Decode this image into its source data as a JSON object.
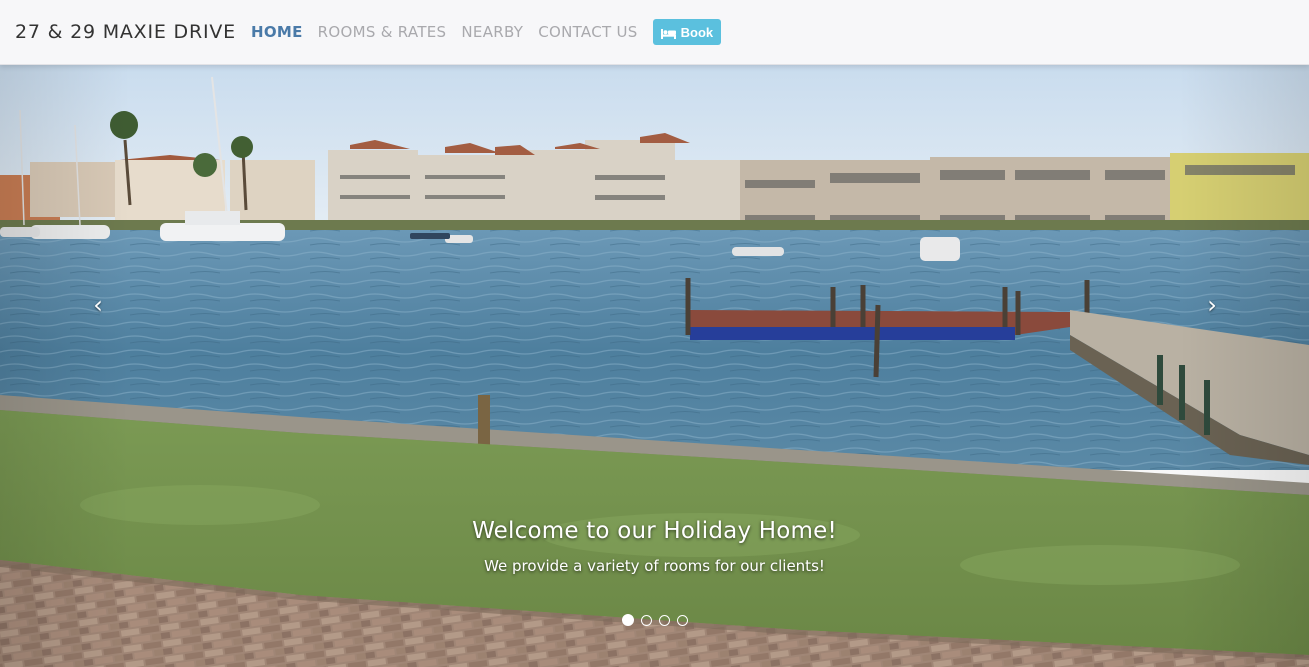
{
  "navbar": {
    "brand": "27 & 29 MAXIE DRIVE",
    "items": [
      {
        "label": "HOME",
        "active": true
      },
      {
        "label": "ROOMS & RATES",
        "active": false
      },
      {
        "label": "NEARBY",
        "active": false
      },
      {
        "label": "CONTACT US",
        "active": false
      }
    ],
    "book_button": {
      "label": "Book",
      "icon": "bed-icon",
      "color": "#5bc0de"
    }
  },
  "carousel": {
    "caption": {
      "title": "Welcome to our Holiday Home!",
      "text": "We provide a variety of rooms for our clients!"
    },
    "prev_label": "‹",
    "next_label": "›",
    "indicators": [
      {
        "active": true
      },
      {
        "active": false
      },
      {
        "active": false
      },
      {
        "active": false
      }
    ]
  },
  "colors": {
    "nav_active": "#4a7aa8",
    "nav_inactive": "#a9a9ad",
    "navbar_bg": "#f7f7f9"
  }
}
